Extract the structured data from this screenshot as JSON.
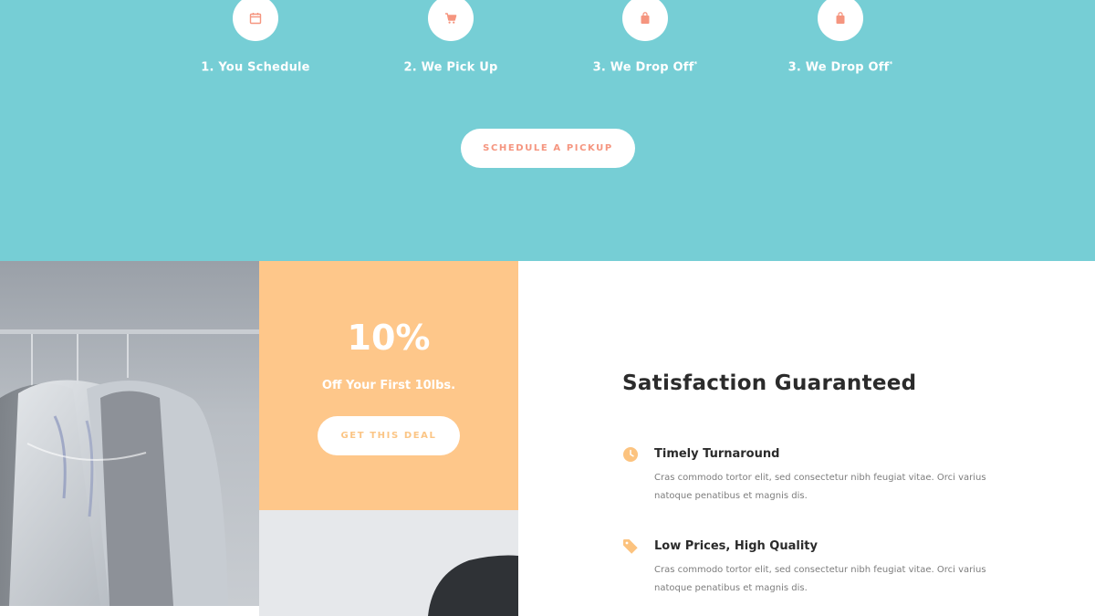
{
  "steps": [
    {
      "label": "1. You Schedule",
      "icon": "calendar-icon",
      "sup": ""
    },
    {
      "label": "2. We Pick Up",
      "icon": "cart-icon",
      "sup": ""
    },
    {
      "label": "3. We Drop Off",
      "icon": "bag-icon",
      "sup": "*"
    },
    {
      "label": "3. We Drop Off",
      "icon": "bag-icon",
      "sup": "*"
    }
  ],
  "cta": {
    "schedule_label": "SCHEDULE A PICKUP"
  },
  "deal": {
    "percent": "10%",
    "subtitle": "Off Your First 10lbs.",
    "button_label": "GET THIS DEAL"
  },
  "satisfaction": {
    "title": "Satisfaction Guaranteed",
    "features": [
      {
        "icon": "clock-icon",
        "title": "Timely Turnaround",
        "description": "Cras commodo tortor elit, sed consectetur nibh feugiat vitae. Orci varius natoque penatibus et magnis dis."
      },
      {
        "icon": "price-tag-icon",
        "title": "Low Prices, High Quality",
        "description": "Cras commodo tortor elit, sed consectetur nibh feugiat vitae. Orci varius natoque penatibus et magnis dis."
      }
    ]
  },
  "colors": {
    "teal": "#76ced5",
    "coral": "#f5957f",
    "peach": "#fec78a",
    "gray_panel": "#e6e8eb"
  }
}
